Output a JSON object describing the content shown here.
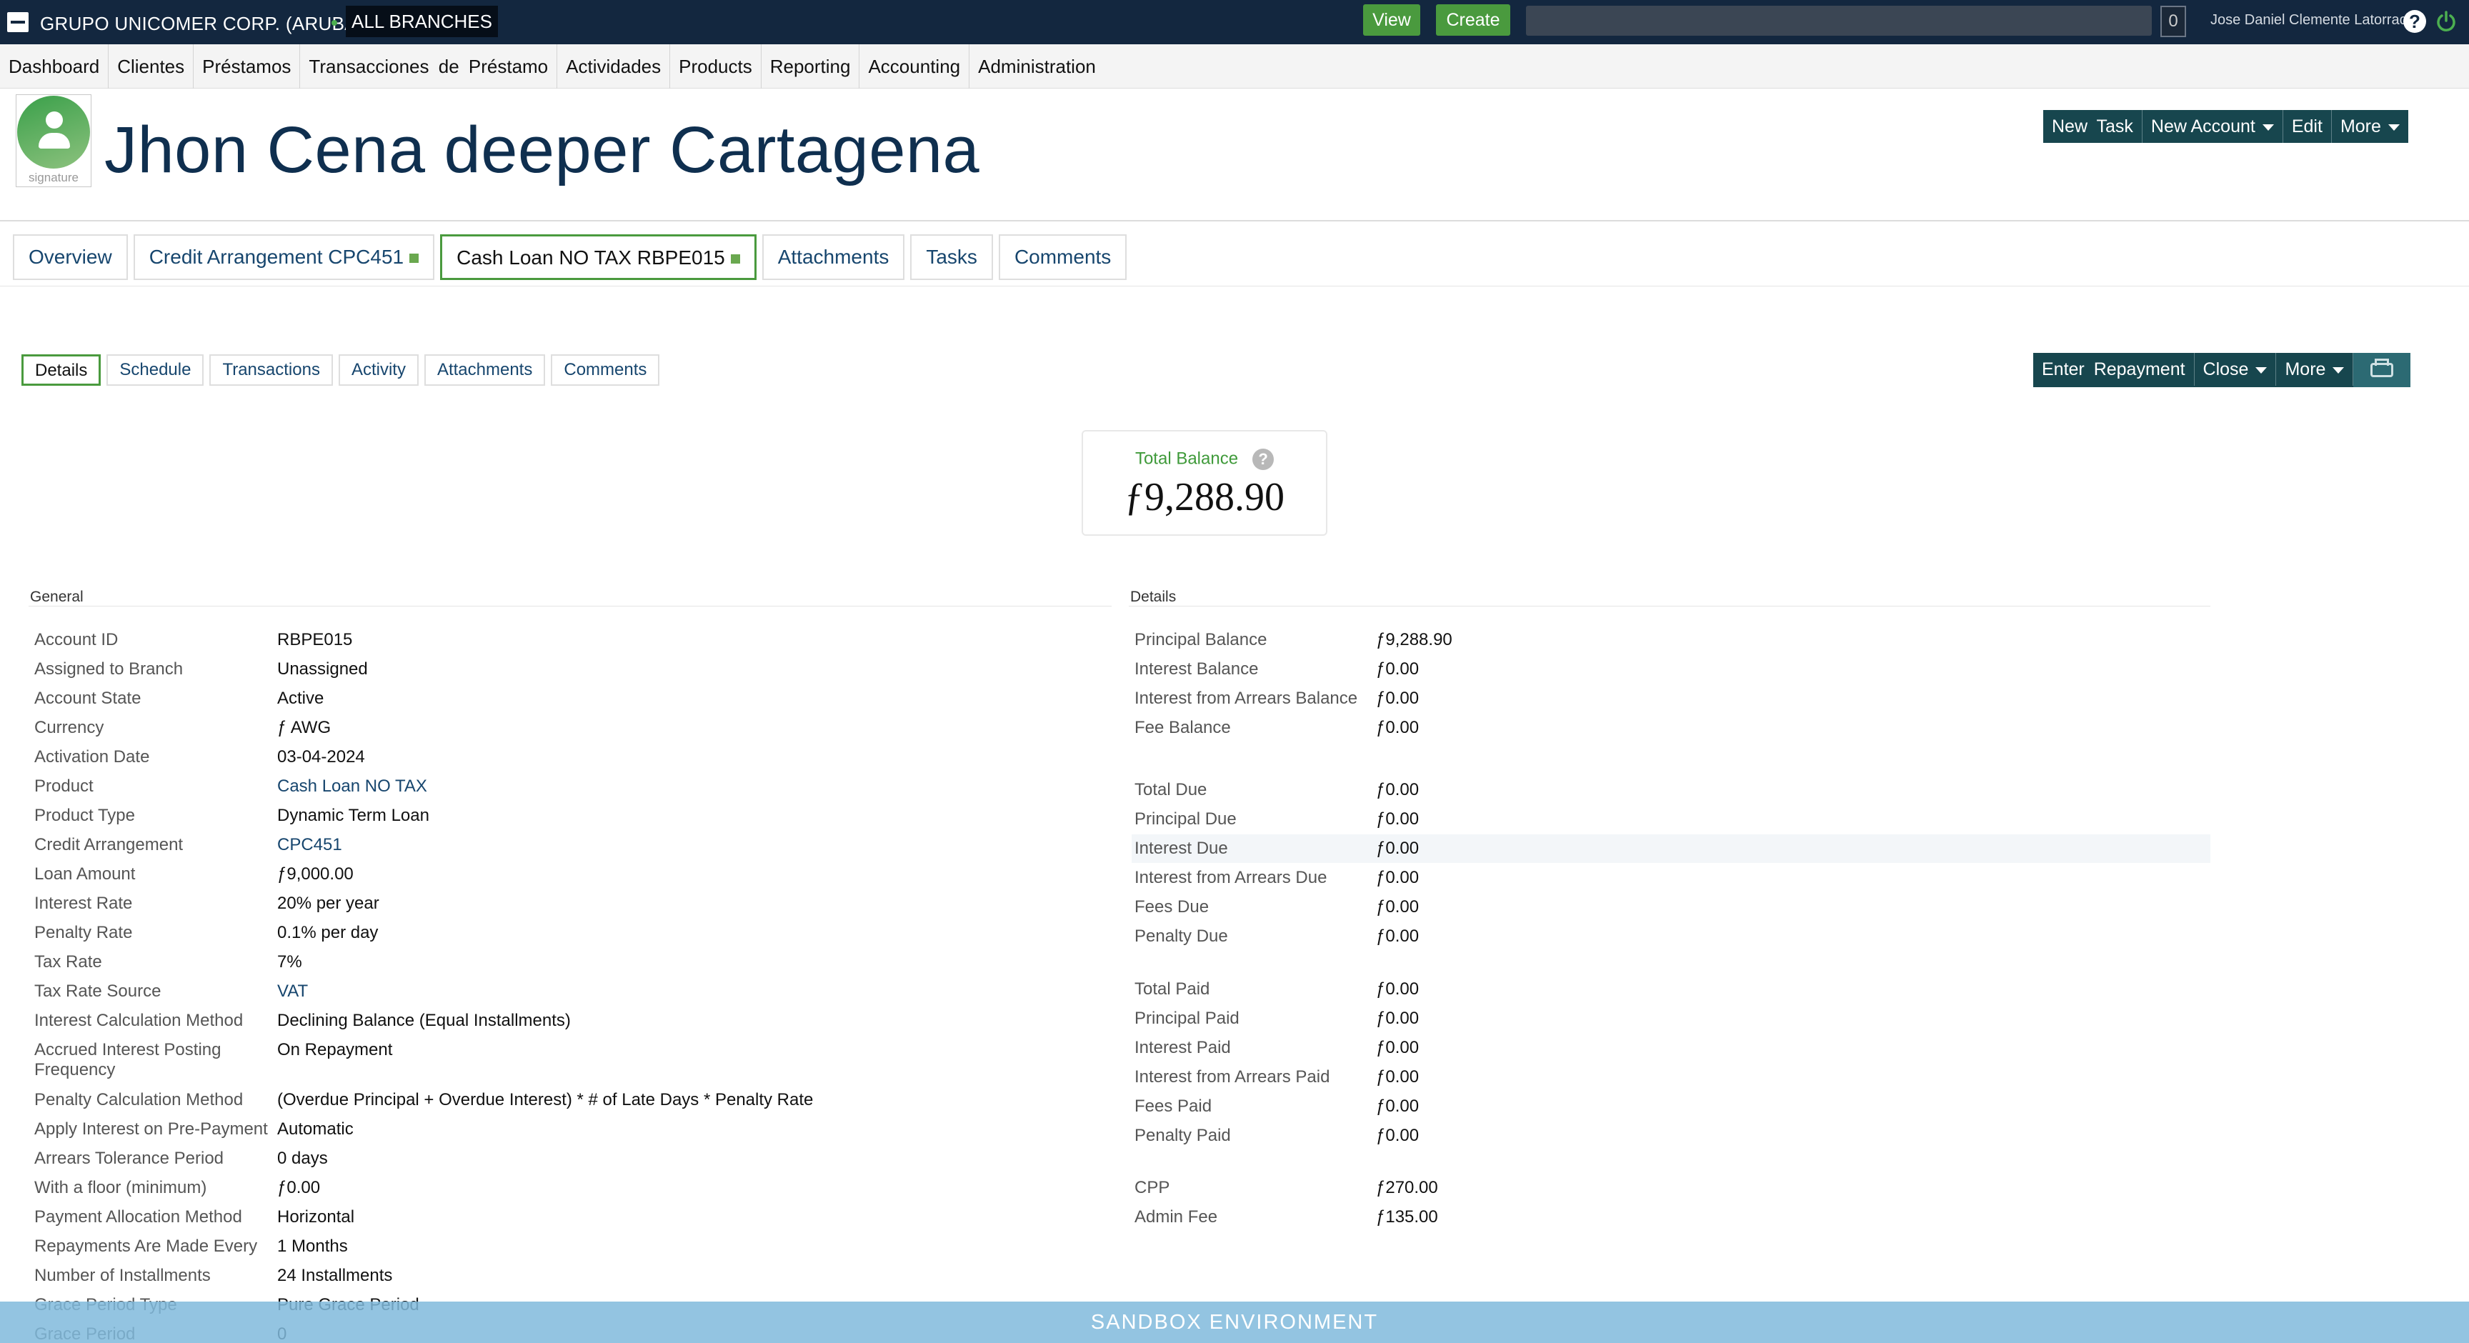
{
  "topbar": {
    "org": "GRUPO UNICOMER CORP. (ARUBA)",
    "branch": "ALL BRANCHES",
    "view_label": "View",
    "create_label": "Create",
    "search_value": "",
    "notification_count": "0",
    "user_name": "Jose Daniel Clemente Latorraca",
    "help_glyph": "?"
  },
  "nav": [
    "Dashboard",
    "Clientes",
    "Préstamos",
    "Transacciones de Préstamo",
    "Actividades",
    "Products",
    "Reporting",
    "Accounting",
    "Administration"
  ],
  "client": {
    "name": "Jhon Cena deeper Cartagena",
    "signature_label": "signature"
  },
  "header_actions": {
    "new_task": "New Task",
    "new_account": "New Account",
    "edit": "Edit",
    "more": "More"
  },
  "tabs": [
    "Overview",
    "Credit Arrangement CPC451",
    "Cash Loan NO TAX RBPE015",
    "Attachments",
    "Tasks",
    "Comments"
  ],
  "subtabs": [
    "Details",
    "Schedule",
    "Transactions",
    "Activity",
    "Attachments",
    "Comments"
  ],
  "sub_actions": {
    "enter_repayment": "Enter Repayment",
    "close": "Close",
    "more": "More"
  },
  "total_balance": {
    "label": "Total Balance",
    "help": "?",
    "amount": "ƒ9,288.90"
  },
  "general": {
    "title": "General",
    "rows": [
      {
        "k": "Account ID",
        "v": "RBPE015"
      },
      {
        "k": "Assigned to Branch",
        "v": "Unassigned"
      },
      {
        "k": "Account State",
        "v": "Active"
      },
      {
        "k": "Currency",
        "v": "ƒ AWG"
      },
      {
        "k": "Activation Date",
        "v": "03-04-2024"
      },
      {
        "k": "Product",
        "v": "Cash Loan NO TAX"
      },
      {
        "k": "Product Type",
        "v": "Dynamic Term Loan"
      },
      {
        "k": "Credit Arrangement",
        "v": "CPC451"
      },
      {
        "k": "Loan Amount",
        "v": "ƒ9,000.00"
      },
      {
        "k": "Interest Rate",
        "v": "20% per year"
      },
      {
        "k": "Penalty Rate",
        "v": "0.1% per day"
      },
      {
        "k": "Tax Rate",
        "v": "7%"
      },
      {
        "k": "Tax Rate Source",
        "v": "VAT"
      },
      {
        "k": "Interest Calculation Method",
        "v": "Declining Balance (Equal Installments)"
      },
      {
        "k": "Accrued Interest Posting",
        "k2": "Frequency",
        "v": "On Repayment"
      },
      {
        "k": "Penalty Calculation Method",
        "v": "(Overdue Principal + Overdue Interest) * # of Late Days * Penalty Rate"
      },
      {
        "k": "Apply Interest on Pre-Payment",
        "v": "Automatic"
      },
      {
        "k": "Arrears Tolerance Period",
        "v": "0 days"
      },
      {
        "k": "With a floor (minimum)",
        "v": "ƒ0.00"
      },
      {
        "k": "Payment Allocation Method",
        "v": "Horizontal"
      },
      {
        "k": "Repayments Are Made Every",
        "v": "1 Months"
      },
      {
        "k": "Number of Installments",
        "v": "24 Installments"
      },
      {
        "k": "Grace Period Type",
        "v": "Pure Grace Period"
      },
      {
        "k": "Grace Period",
        "v": "0"
      }
    ]
  },
  "details": {
    "title": "Details",
    "rows": [
      {
        "k": "Principal Balance",
        "v": "ƒ9,288.90"
      },
      {
        "k": "Interest Balance",
        "v": "ƒ0.00"
      },
      {
        "k": "Interest from Arrears Balance",
        "v": "ƒ0.00"
      },
      {
        "k": "Fee Balance",
        "v": "ƒ0.00"
      },
      {
        "k": "Total Due",
        "v": "ƒ0.00"
      },
      {
        "k": "Principal Due",
        "v": "ƒ0.00"
      },
      {
        "k": "Interest Due",
        "v": "ƒ0.00"
      },
      {
        "k": "Interest from Arrears Due",
        "v": "ƒ0.00"
      },
      {
        "k": "Fees Due",
        "v": "ƒ0.00"
      },
      {
        "k": "Penalty Due",
        "v": "ƒ0.00"
      },
      {
        "k": "Total Paid",
        "v": "ƒ0.00"
      },
      {
        "k": "Principal Paid",
        "v": "ƒ0.00"
      },
      {
        "k": "Interest Paid",
        "v": "ƒ0.00"
      },
      {
        "k": "Interest from Arrears Paid",
        "v": "ƒ0.00"
      },
      {
        "k": "Fees Paid",
        "v": "ƒ0.00"
      },
      {
        "k": "Penalty Paid",
        "v": "ƒ0.00"
      },
      {
        "k": "CPP",
        "v": "ƒ270.00"
      },
      {
        "k": "Admin Fee",
        "v": "ƒ135.00"
      }
    ]
  },
  "banner": "SANDBOX ENVIRONMENT",
  "colors": {
    "topbar": "#13273f",
    "green_button": "#4a9a3e",
    "action_bar": "#17464e",
    "link": "#17466e"
  },
  "icons": [
    "logo-icon",
    "help-icon",
    "power-icon",
    "person-icon",
    "caret-down-icon",
    "printer-icon",
    "question-icon"
  ]
}
